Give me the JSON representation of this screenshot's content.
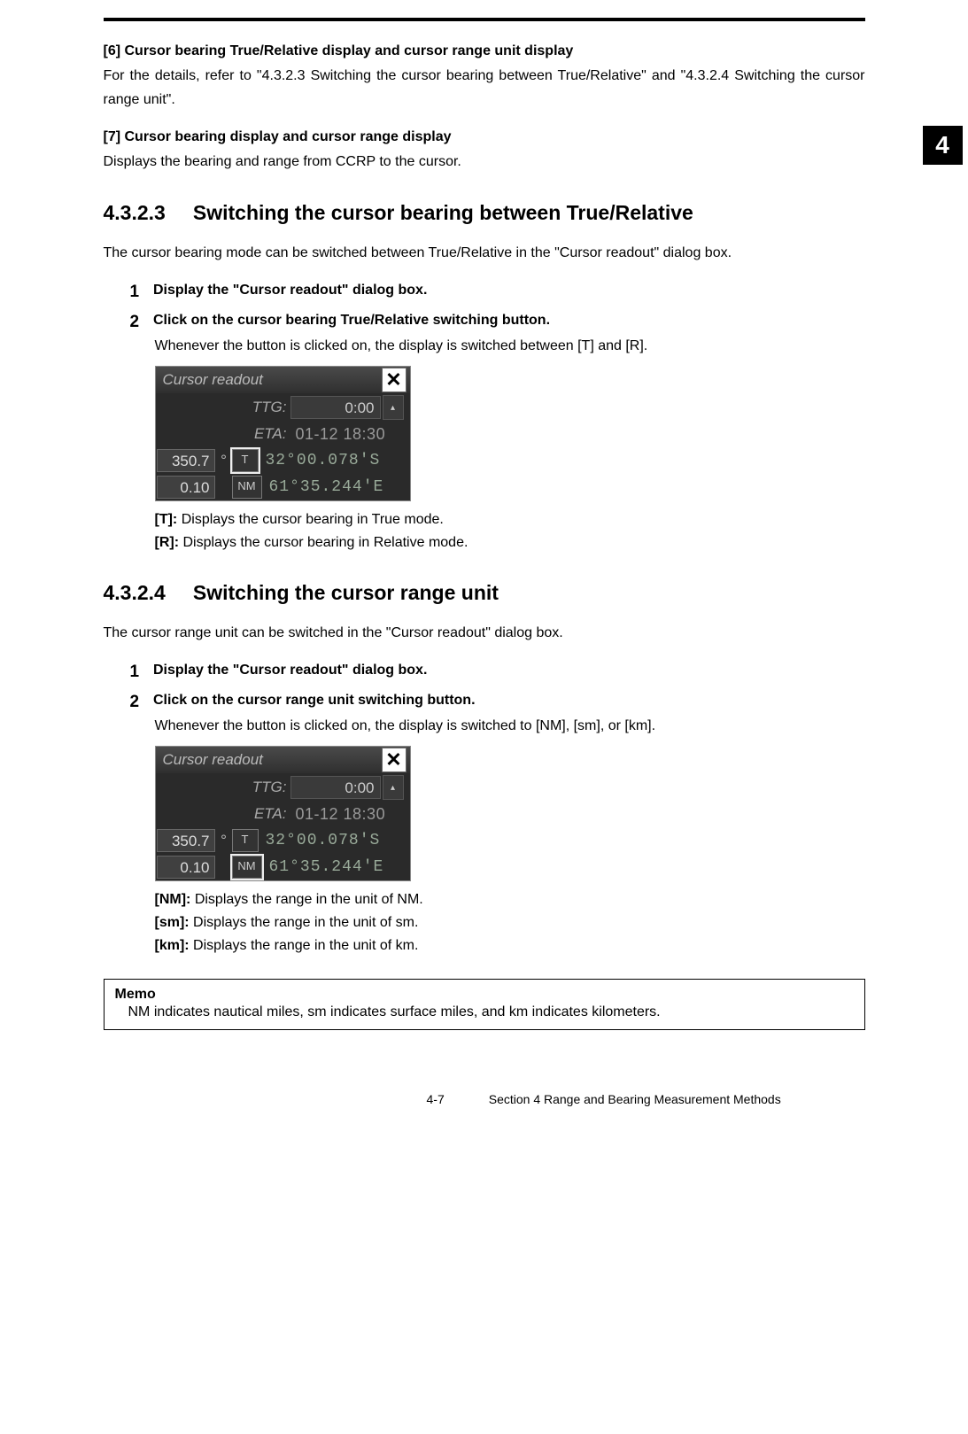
{
  "chapter_tab": "4",
  "intro": {
    "item6_heading": "[6] Cursor bearing True/Relative display and cursor range unit display",
    "item6_text": "For the details, refer to \"4.3.2.3 Switching the cursor bearing between True/Relative\" and \"4.3.2.4 Switching the cursor range unit\".",
    "item7_heading": "[7] Cursor bearing display and cursor range display",
    "item7_text": "Displays the bearing and range from CCRP to the cursor."
  },
  "section_4323": {
    "num": "4.3.2.3",
    "title": "Switching the cursor bearing between True/Relative",
    "lead": "The cursor bearing mode can be switched between True/Relative in the \"Cursor readout\" dialog box.",
    "step1": "Display the \"Cursor readout\" dialog box.",
    "step2_title": "Click on the cursor bearing True/Relative switching button.",
    "step2_body": "Whenever the button is clicked on, the display is switched between [T] and [R].",
    "defs": {
      "t": "[T]:",
      "t_text": " Displays the cursor bearing in True mode.",
      "r": "[R]:",
      "r_text": " Displays the cursor bearing in Relative mode."
    }
  },
  "section_4324": {
    "num": "4.3.2.4",
    "title": "Switching the cursor range unit",
    "lead": "The cursor range unit can be switched in the \"Cursor readout\" dialog box.",
    "step1": "Display the \"Cursor readout\" dialog box.",
    "step2_title": "Click on the cursor range unit switching button.",
    "step2_body": "Whenever the button is clicked on, the display is switched to [NM], [sm], or [km].",
    "defs": {
      "nm": "[NM]:",
      "nm_text": " Displays the range in the unit of NM.",
      "sm": "[sm]:",
      "sm_text": " Displays the range in the unit of sm.",
      "km": "[km]:",
      "km_text": " Displays the range in the unit of km."
    }
  },
  "memo": {
    "title": "Memo",
    "text": "NM indicates nautical miles, sm indicates surface miles, and km indicates kilometers."
  },
  "widget": {
    "title": "Cursor readout",
    "ttg_label": "TTG:",
    "ttg_value": "0:00",
    "eta_label": "ETA:",
    "eta_value": "01-12 18:30",
    "bearing": "350.7",
    "range": "0.10",
    "t_button": "T",
    "nm_button": "NM",
    "lat": "32°00.078'S",
    "lon": "61°35.244'E"
  },
  "footer": {
    "page": "4-7",
    "section": "Section 4    Range and Bearing Measurement Methods"
  }
}
